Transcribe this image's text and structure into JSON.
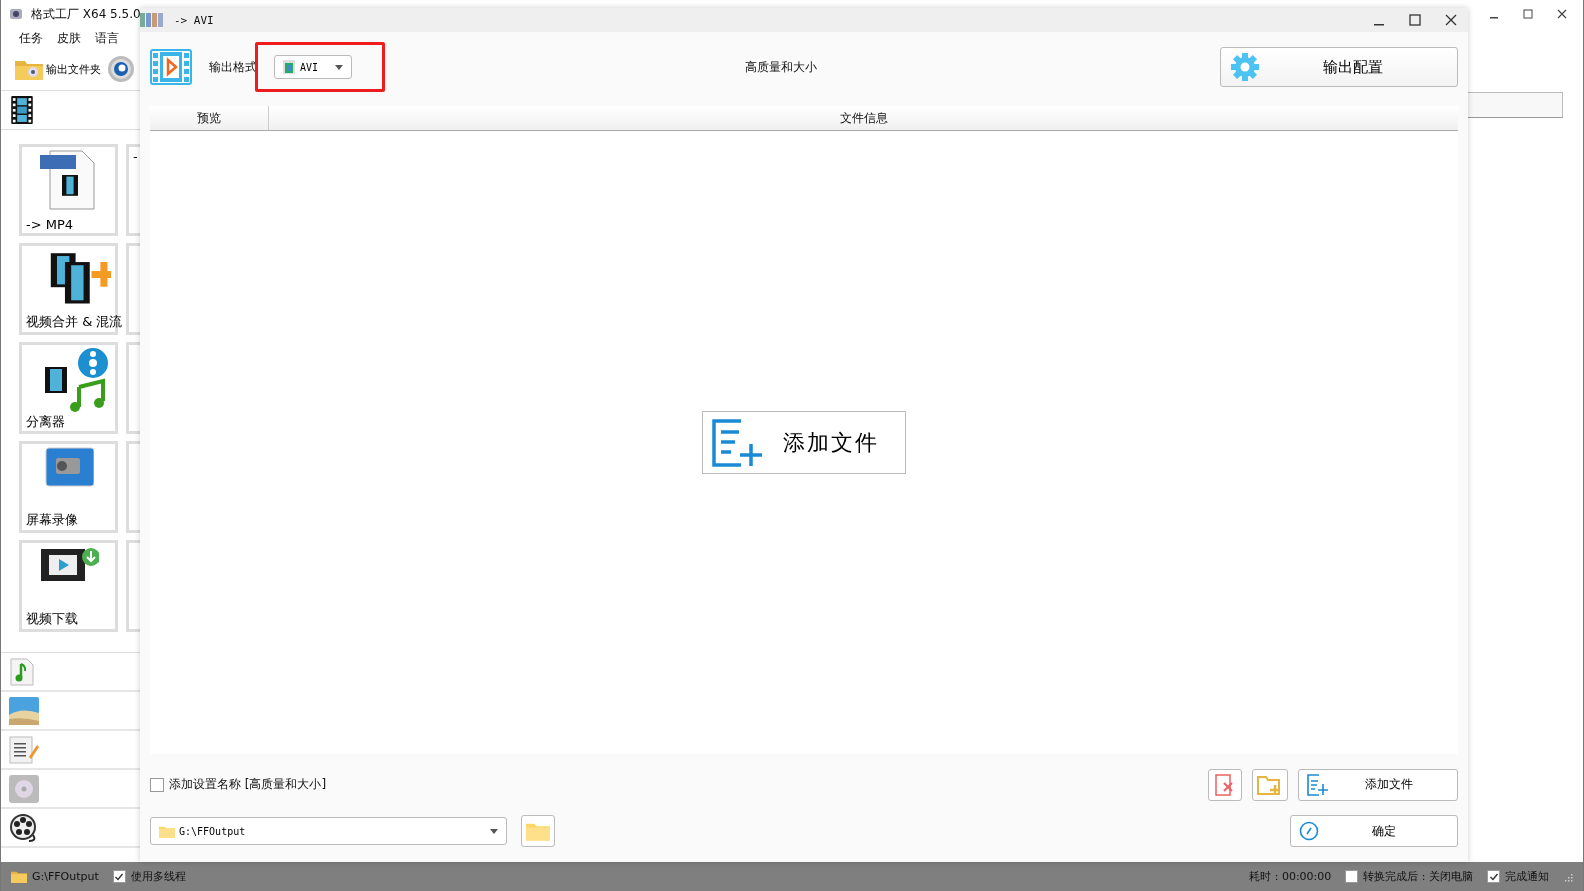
{
  "main_window": {
    "title": "格式工厂 X64 5.5.0",
    "menu": [
      "任务",
      "皮肤",
      "语言"
    ],
    "output_folder_button": "输出文件夹",
    "tiles": [
      {
        "label": "-> MP4",
        "kind": "mp4"
      },
      {
        "label": "视频合并 & 混流",
        "kind": "merge"
      },
      {
        "label": "分离器",
        "kind": "splitter"
      },
      {
        "label": "屏幕录像",
        "kind": "record"
      },
      {
        "label": "视频下载",
        "kind": "download"
      }
    ],
    "partial_tile_label": "-",
    "categories": [
      {
        "kind": "audio"
      },
      {
        "kind": "picture"
      },
      {
        "kind": "document"
      },
      {
        "kind": "disc"
      },
      {
        "kind": "reel"
      }
    ]
  },
  "dialog": {
    "title": "-> AVI",
    "format_label": "输出格式",
    "format": {
      "value": "AVI",
      "highlighted": true
    },
    "quality": "高质量和大小",
    "config_button": "输出配置",
    "columns": [
      "预览",
      "文件信息"
    ],
    "add_file_center": "添加文件",
    "add_name_option": {
      "label": "添加设置名称 [高质量和大小]",
      "checked": false
    },
    "output_path": "G:\\FFOutput",
    "add_file_button": "添加文件",
    "ok_button": "确定"
  },
  "status_bar": {
    "folder": "G:\\FFOutput",
    "multithread": {
      "label": "使用多线程",
      "checked": true
    },
    "elapsed": "耗时 : 00:00:00",
    "shutdown": {
      "label": "转换完成后 : 关闭电脑",
      "checked": false
    },
    "notify": {
      "label": "完成通知",
      "checked": true
    }
  }
}
